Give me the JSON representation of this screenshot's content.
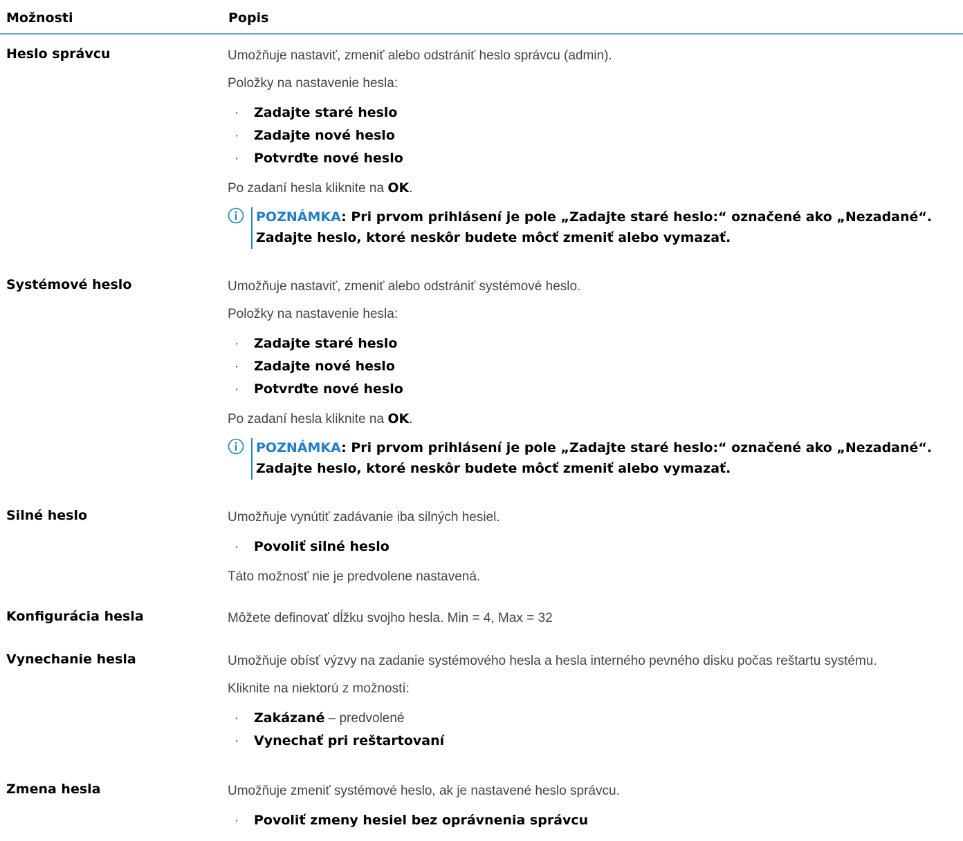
{
  "header": {
    "col_options": "Možnosti",
    "col_description": "Popis"
  },
  "rows": [
    {
      "option": "Heslo správcu",
      "intro": "Umožňuje nastaviť, zmeniť alebo odstrániť heslo správcu (admin).",
      "items_label": "Položky na nastavenie hesla:",
      "bullets": [
        "Zadajte staré heslo",
        "Zadajte nové heslo",
        "Potvrďte nové heslo"
      ],
      "after_prefix": "Po zadaní hesla kliknite na ",
      "after_bold": "OK",
      "after_suffix": ".",
      "note_label": "POZNÁMKA",
      "note_text": ": Pri prvom prihlásení je pole „Zadajte staré heslo:“ označené ako „Nezadané“. Zadajte heslo, ktoré neskôr budete môcť zmeniť alebo vymazať."
    },
    {
      "option": "Systémové heslo",
      "intro": "Umožňuje nastaviť, zmeniť alebo odstrániť systémové heslo.",
      "items_label": "Položky na nastavenie hesla:",
      "bullets": [
        "Zadajte staré heslo",
        "Zadajte nové heslo",
        "Potvrďte nové heslo"
      ],
      "after_prefix": "Po zadaní hesla kliknite na ",
      "after_bold": "OK",
      "after_suffix": ".",
      "note_label": "POZNÁMKA",
      "note_text": ": Pri prvom prihlásení je pole „Zadajte staré heslo:“ označené ako „Nezadané“. Zadajte heslo, ktoré neskôr budete môcť zmeniť alebo vymazať."
    },
    {
      "option": "Silné heslo",
      "intro": "Umožňuje vynútiť zadávanie iba silných hesiel.",
      "bullet": "Povoliť silné heslo",
      "after": "Táto možnosť nie je predvolene nastavená."
    },
    {
      "option": "Konfigurácia hesla",
      "intro": "Môžete definovať dĺžku svojho hesla. Min = 4, Max = 32"
    },
    {
      "option": "Vynechanie hesla",
      "intro": "Umožňuje obísť výzvy na zadanie systémového hesla a hesla interného pevného disku počas reštartu systému.",
      "choose_label": "Kliknite na niektorú z možností:",
      "bullet1_bold": "Zakázané",
      "bullet1_rest": " – predvolené",
      "bullet2": "Vynechať pri reštartovaní"
    },
    {
      "option": "Zmena hesla",
      "intro": "Umožňuje zmeniť systémové heslo, ak je nastavené heslo správcu.",
      "bullet": "Povoliť zmeny hesiel bez oprávnenia správcu"
    }
  ],
  "colors": {
    "accent": "#1f7fc7",
    "header_rule": "#6ea1cc",
    "body_text": "#444444",
    "strong_text": "#000000"
  },
  "icons": {
    "note": "info-icon"
  }
}
